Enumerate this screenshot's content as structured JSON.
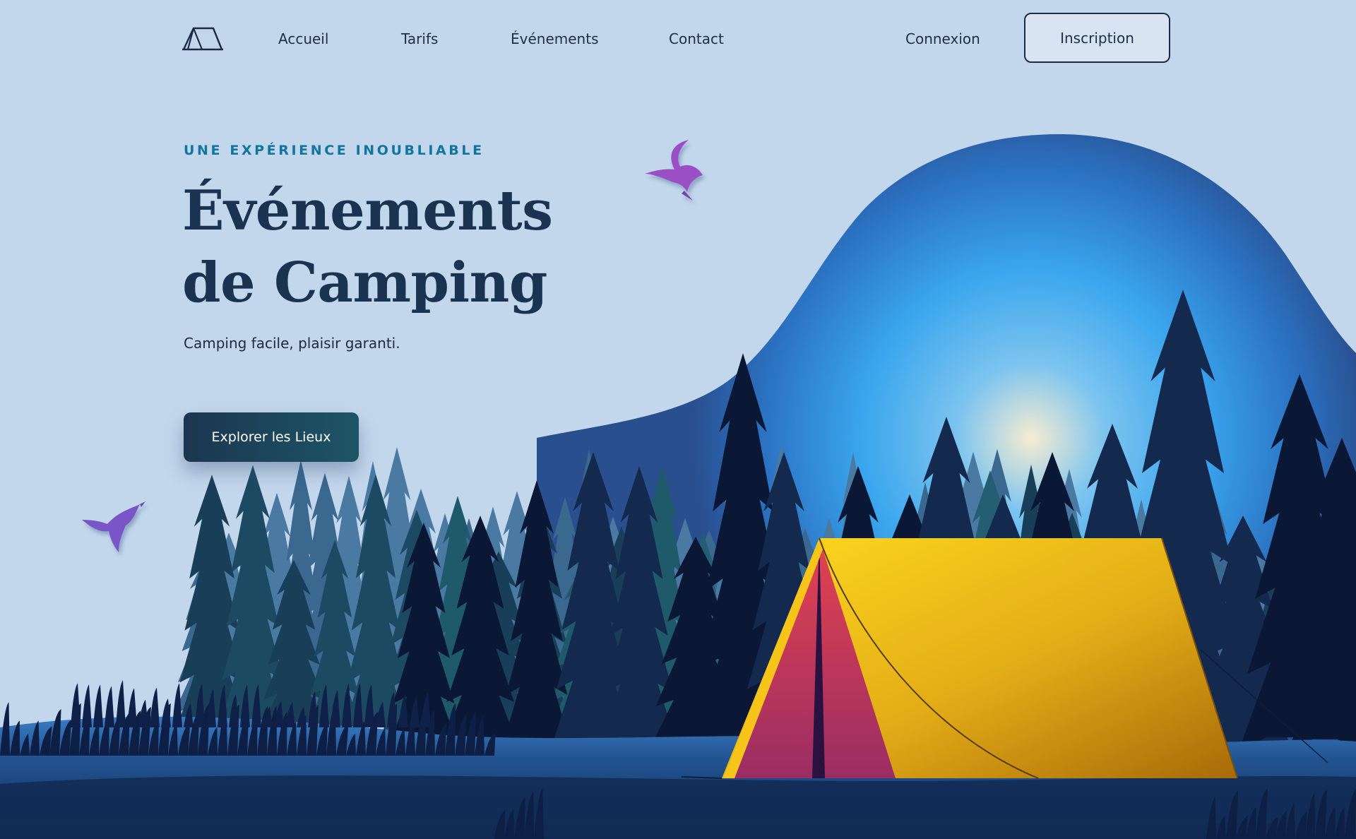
{
  "colors": {
    "background": "#c3d7ec",
    "eyebrow": "#11759d",
    "title": "#1a3350",
    "cta_bg": "#1d4a60",
    "tent_yellow": "#f3c21c",
    "tent_red": "#d94356",
    "bird_purple": "#8b4ec4"
  },
  "nav": {
    "logo_icon": "tent-icon",
    "links": {
      "home": "Accueil",
      "pricing": "Tarifs",
      "events": "Événements",
      "contact": "Contact"
    },
    "login": "Connexion",
    "signup": "Inscription"
  },
  "hero": {
    "eyebrow": "UNE EXPÉRIENCE INOUBLIABLE",
    "title_line1": "Événements",
    "title_line2": "de Camping",
    "subtitle": "Camping facile, plaisir garanti.",
    "cta": "Explorer les Lieux"
  },
  "illustration": {
    "elements": [
      "night-sky-blob",
      "pine-forest",
      "tent",
      "hummingbird-icon",
      "hummingbird-icon",
      "grass"
    ]
  }
}
